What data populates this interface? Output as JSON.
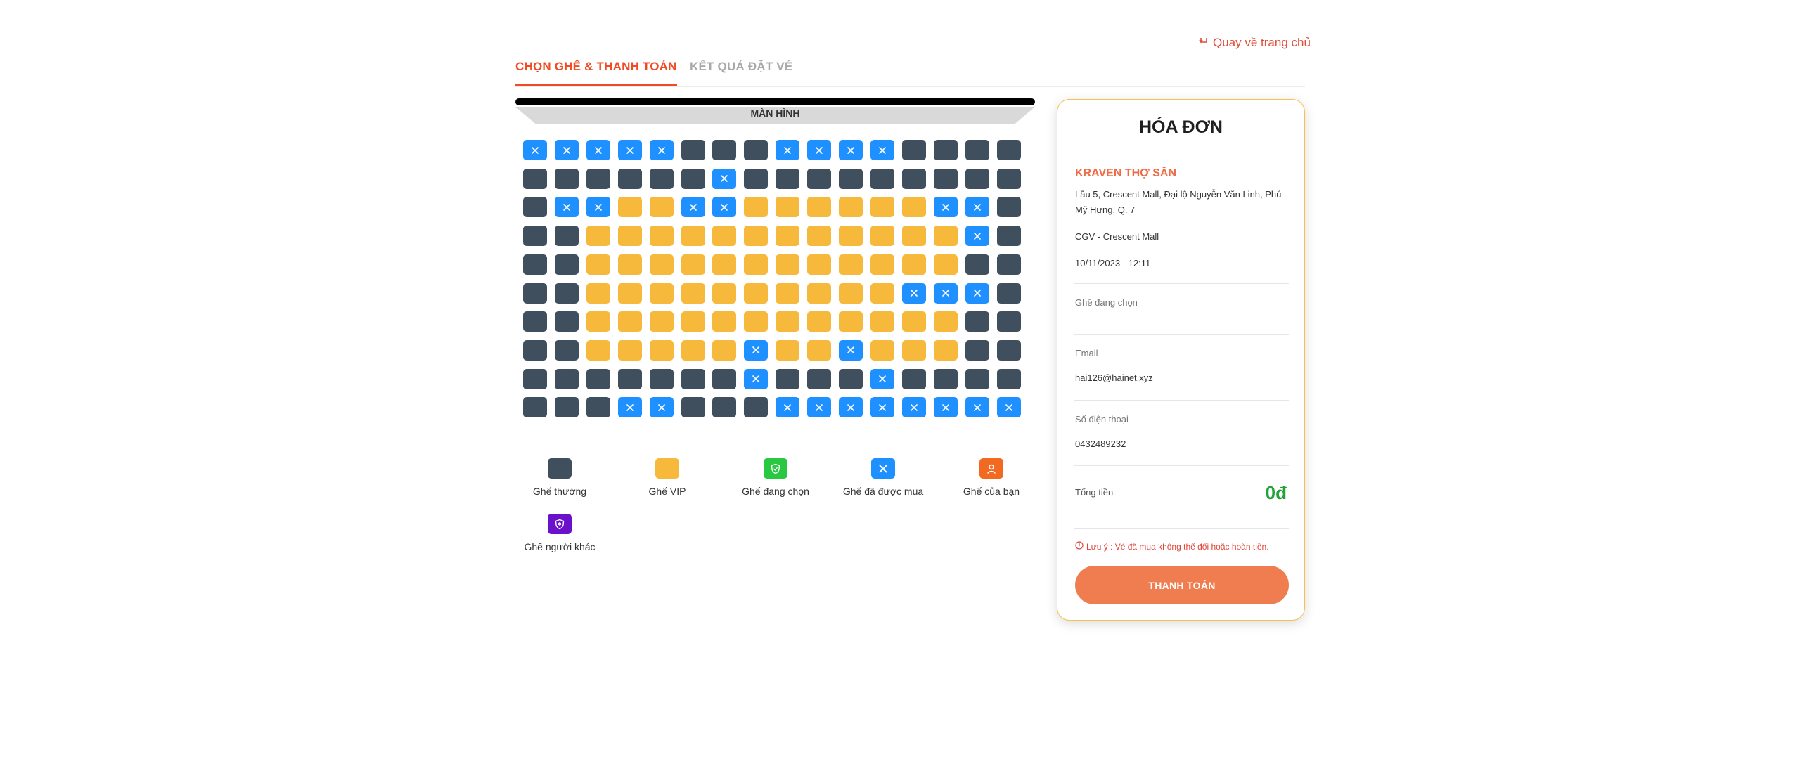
{
  "header": {
    "back_label": "Quay về trang chủ"
  },
  "tabs": [
    {
      "label": "CHỌN GHẾ & THANH TOÁN",
      "active": true
    },
    {
      "label": "KẾT QUẢ ĐẶT VÉ",
      "active": false
    }
  ],
  "screen": {
    "label": "MÀN HÌNH"
  },
  "seat_map": {
    "rows": [
      "BBBBBNNNBBBBNNNN",
      "NNNNNNBNNNNNNNNN",
      "NBBVVBBVVVVVVBBN",
      "NNVVVVVVVVVVVVBN",
      "NNVVVVVVVVVVVVNN",
      "NNVVVVVVVVVVBBBN",
      "NNVVVVVVVVVVVVNN",
      "NNVVVVVBVVBVVVNN",
      "NNNNNNNBNNNBNNNN",
      "NNNBBNNNBBBBBBBB"
    ],
    "legend_code": {
      "N": "normal",
      "V": "vip",
      "B": "booked"
    }
  },
  "legend": [
    {
      "label": "Ghế thường",
      "color": "#3f4f5d",
      "icon": "none"
    },
    {
      "label": "Ghế VIP",
      "color": "#f6b93b",
      "icon": "none"
    },
    {
      "label": "Ghế đang chọn",
      "color": "#28c840",
      "icon": "shield-check-icon"
    },
    {
      "label": "Ghế đã được mua",
      "color": "#1e90ff",
      "icon": "close-icon"
    },
    {
      "label": "Ghế của bạn",
      "color": "#f26a22",
      "icon": "user-icon"
    },
    {
      "label": "Ghế người khác",
      "color": "#6a11cb",
      "icon": "shield-icon"
    }
  ],
  "invoice": {
    "title": "HÓA ĐƠN",
    "movie": "KRAVEN THỢ SĂN",
    "address": "Lầu 5, Crescent Mall, Đại lộ Nguyễn Văn Linh, Phú Mỹ Hưng, Q. 7",
    "cinema": "CGV - Crescent Mall",
    "datetime": "10/11/2023 - 12:11",
    "selected_label": "Ghế đang chọn",
    "selected_value": "",
    "email_label": "Email",
    "email_value": "hai126@hainet.xyz",
    "phone_label": "Số điện thoại",
    "phone_value": "0432489232",
    "total_label": "Tổng tiền",
    "total_value": "0đ",
    "note": "Lưu ý : Vé đã mua không thể đổi hoặc hoàn tiền.",
    "pay_label": "THANH TOÁN"
  },
  "colors": {
    "accent": "#f04b23",
    "pay": "#f07d50",
    "total": "#22a33a",
    "booked": "#1e90ff",
    "vip": "#f6b93b",
    "normal": "#3f4f5d"
  }
}
